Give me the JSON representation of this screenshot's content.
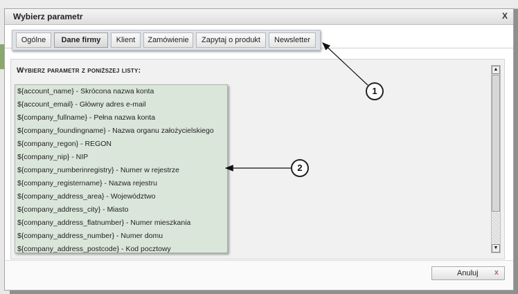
{
  "dialog": {
    "title": "Wybierz parametr",
    "close_label": "X"
  },
  "tabs": [
    {
      "label": "Ogólne",
      "active": false
    },
    {
      "label": "Dane firmy",
      "active": true
    },
    {
      "label": "Klient",
      "active": false
    },
    {
      "label": "Zamówienie",
      "active": false
    },
    {
      "label": "Zapytaj o produkt",
      "active": false
    },
    {
      "label": "Newsletter",
      "active": false
    }
  ],
  "content": {
    "heading": "Wybierz parametr z poniższej listy:",
    "params": [
      "${account_name} - Skrócona nazwa konta",
      "${account_email} - Główny adres e-mail",
      "${company_fullname} - Pełna nazwa konta",
      "${company_foundingname} - Nazwa organu założycielskiego",
      "${company_regon} - REGON",
      "${company_nip} - NIP",
      "${company_numberinregistry} - Numer w rejestrze",
      "${company_registername} - Nazwa rejestru",
      "${company_address_area} - Województwo",
      "${company_address_city} - Miasto",
      "${company_address_flatnumber} - Numer mieszkania",
      "${company_address_number} - Numer domu",
      "${company_address_postcode} - Kod pocztowy"
    ]
  },
  "footer": {
    "cancel_label": "Anuluj",
    "cancel_icon": "x"
  },
  "callouts": [
    "1",
    "2"
  ],
  "scrollbar": {
    "up_icon": "▲",
    "down_icon": "▼"
  }
}
